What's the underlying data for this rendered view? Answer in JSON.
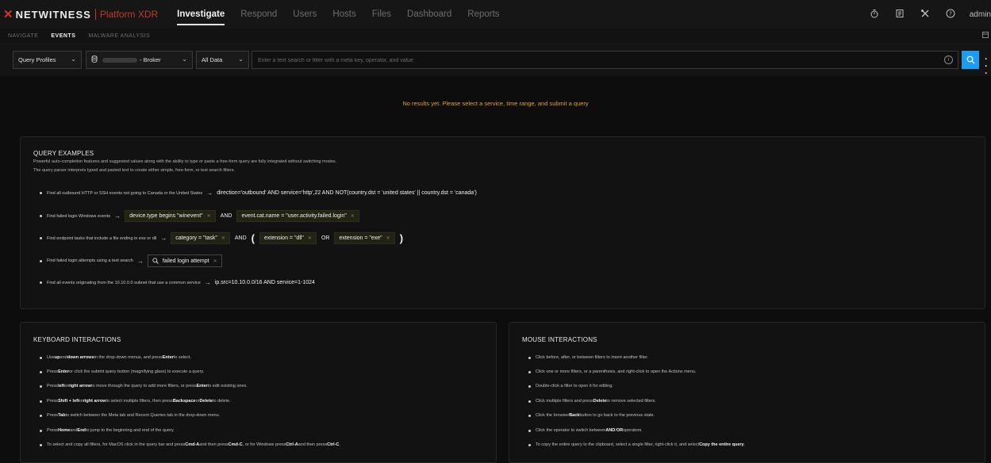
{
  "brand": {
    "logo_text": "NETWITNESS",
    "product": "Platform XDR",
    "accent": "#d9332d"
  },
  "nav": {
    "items": [
      "Investigate",
      "Respond",
      "Users",
      "Hosts",
      "Files",
      "Dashboard",
      "Reports"
    ],
    "active": "Investigate"
  },
  "top_icons": [
    "timer-icon",
    "notes-icon",
    "tools-icon",
    "help-icon"
  ],
  "user": {
    "label": "admin"
  },
  "subnav": {
    "items": [
      "NAVIGATE",
      "EVENTS",
      "MALWARE ANALYSIS"
    ],
    "active": "EVENTS"
  },
  "query_bar": {
    "profiles_label": "Query Profiles",
    "service_suffix": "- Broker",
    "time_range_label": "All Data",
    "placeholder": "Enter a text search or filter with a meta key, operator, and value",
    "search_color": "#1e9cf0"
  },
  "status_message": "No results yet. Please select a service, time range, and submit a query",
  "query_examples": {
    "title": "QUERY EXAMPLES",
    "desc1": "Powerful auto-completion features and suggested values along with the ability to type or paste a free-form query are fully integrated without switching modes.",
    "desc2": "The query parser interprets typed and pasted text to create either simple, free-form, or text search filters.",
    "ex1": {
      "label": "Find all outbound HTTP or SSH events not going to Canada or the United States",
      "query": "direction='outbound' AND service='http',22 AND NOT(country.dst = 'united states' || country.dst = 'canada')"
    },
    "ex2": {
      "label": "Find failed login Windows events",
      "pill1": "device.type begins \"winevent\"",
      "op": "AND",
      "pill2": "event.cat.name = \"user.activity.failed.login\""
    },
    "ex3": {
      "label": "Find endpoint tasks that include a file ending in exe or dll",
      "pill1": "category = \"task\"",
      "op1": "AND",
      "open_paren": "(",
      "pill2": "extension = \"dll\"",
      "op2": "OR",
      "pill3": "extension = \"exe\"",
      "close_paren": ")"
    },
    "ex4": {
      "label": "Find failed login attempts using a text search",
      "pill": "failed login attempt"
    },
    "ex5": {
      "label": "Find all events originating from the 10.10.0.0 subnet that use a common service",
      "query": "ip.src=10.10.0.0/16 AND service=1-1024"
    }
  },
  "keyboard": {
    "title": "KEYBOARD INTERACTIONS",
    "items": [
      {
        "a": "Use ",
        "b": "up",
        "c": " and ",
        "d": "down arrows",
        "e": " in the drop-down menus, and press ",
        "f": "Enter",
        "g": " to select."
      },
      {
        "a": "Press ",
        "b": "Enter",
        "c": " or click the submit query button (magnifying glass) to execute a query.",
        "d": "",
        "e": "",
        "f": "",
        "g": ""
      },
      {
        "a": "Press ",
        "b": "left",
        "c": " or ",
        "d": "right arrow",
        "e": " to move through the query to add more filters, or press ",
        "f": "Enter",
        "g": " to edit existing ones."
      },
      {
        "a": "Press ",
        "b": "Shift + left",
        "c": " or ",
        "d": "right arrow",
        "e": " to select multiple filters, then press ",
        "f": "Backspace",
        "g": " or ",
        "h": "Delete",
        "i": " to delete."
      },
      {
        "a": "Press ",
        "b": "Tab",
        "c": " to switch between the Meta tab and Recent Queries tab in the drop-down menu.",
        "d": "",
        "e": "",
        "f": "",
        "g": ""
      },
      {
        "a": "Press ",
        "b": "Home",
        "c": " and ",
        "d": "End",
        "e": " to jump to the beginning and end of the query.",
        "f": "",
        "g": ""
      },
      {
        "a": "To select and copy all filters, for MacOS click in the query bar and press ",
        "b": "Cmd-A",
        "c": " and then press ",
        "d": "Cmd-C",
        "e": ", or for Windows press ",
        "f": "Ctrl-A",
        "g": " and then press ",
        "h": "Ctrl-C",
        "i": "."
      }
    ]
  },
  "mouse": {
    "title": "MOUSE INTERACTIONS",
    "items": [
      {
        "a": "Click before, after, or between filters to insert another filter.",
        "b": "",
        "c": ""
      },
      {
        "a": "Click one or more filters, or a parenthesis, and right-click to open the Actions menu.",
        "b": "",
        "c": ""
      },
      {
        "a": "Double-click a filter to open it for editing.",
        "b": "",
        "c": ""
      },
      {
        "a": "Click multiple filters and press ",
        "b": "Delete",
        "c": " to remove selected filters."
      },
      {
        "a": "Click the browser ",
        "b": "Back",
        "c": " button to go back to the previous state."
      },
      {
        "a": "Click the operator to switch between ",
        "b": "AND",
        "c": " / ",
        "d": "OR",
        "e": " operators."
      },
      {
        "a": "To copy the entire query to the clipboard, select a single filter, right-click it, and select ",
        "b": "Copy the entire query",
        "c": "."
      }
    ]
  }
}
